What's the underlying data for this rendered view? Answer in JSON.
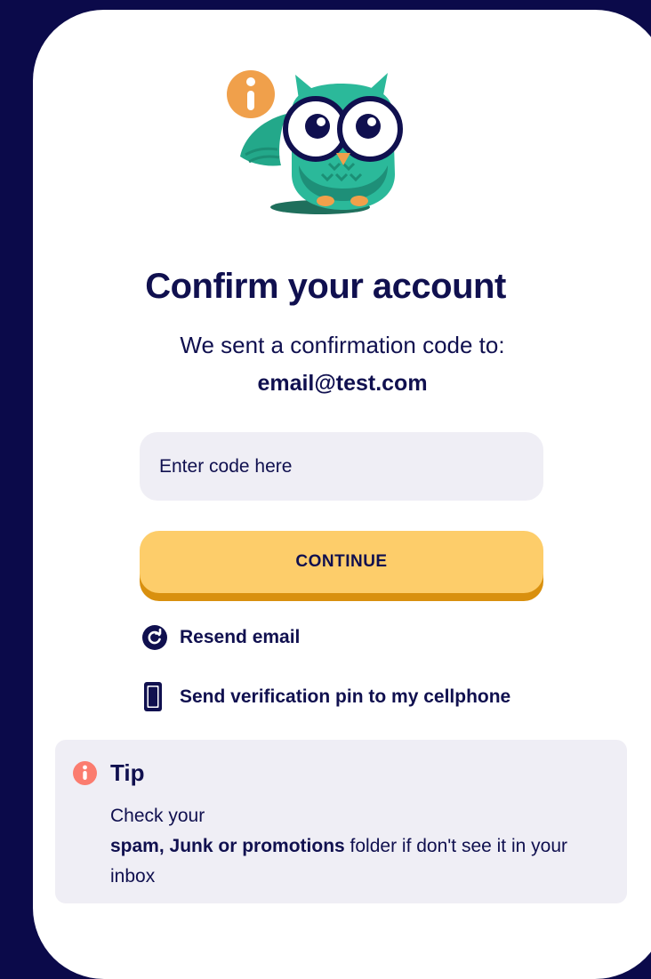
{
  "mascot": {
    "icon": "owl-mascot-icon",
    "badge_icon": "info-icon",
    "badge_color": "#f0a04b",
    "owl_color": "#2bb99a"
  },
  "header": {
    "title": "Confirm your account",
    "subtitle": "We sent a confirmation code to:",
    "email": "email@test.com"
  },
  "form": {
    "code_placeholder": "Enter code here",
    "code_value": "",
    "continue_label": "CONTINUE"
  },
  "actions": {
    "resend_label": "Resend email",
    "resend_icon": "refresh-icon",
    "send_pin_label": "Send verification pin to my cellphone",
    "send_pin_icon": "cellphone-icon"
  },
  "tip": {
    "icon": "info-icon",
    "icon_color": "#fb7c6f",
    "title": "Tip",
    "line1": "Check your",
    "emphasis": "spam, Junk or promotions",
    "rest": " folder if don't see it in your inbox"
  },
  "colors": {
    "background": "#0b0a4a",
    "text": "#10104f",
    "button": "#fdcd6a",
    "button_shadow": "#d9900e",
    "input_bg": "#efeef5"
  }
}
